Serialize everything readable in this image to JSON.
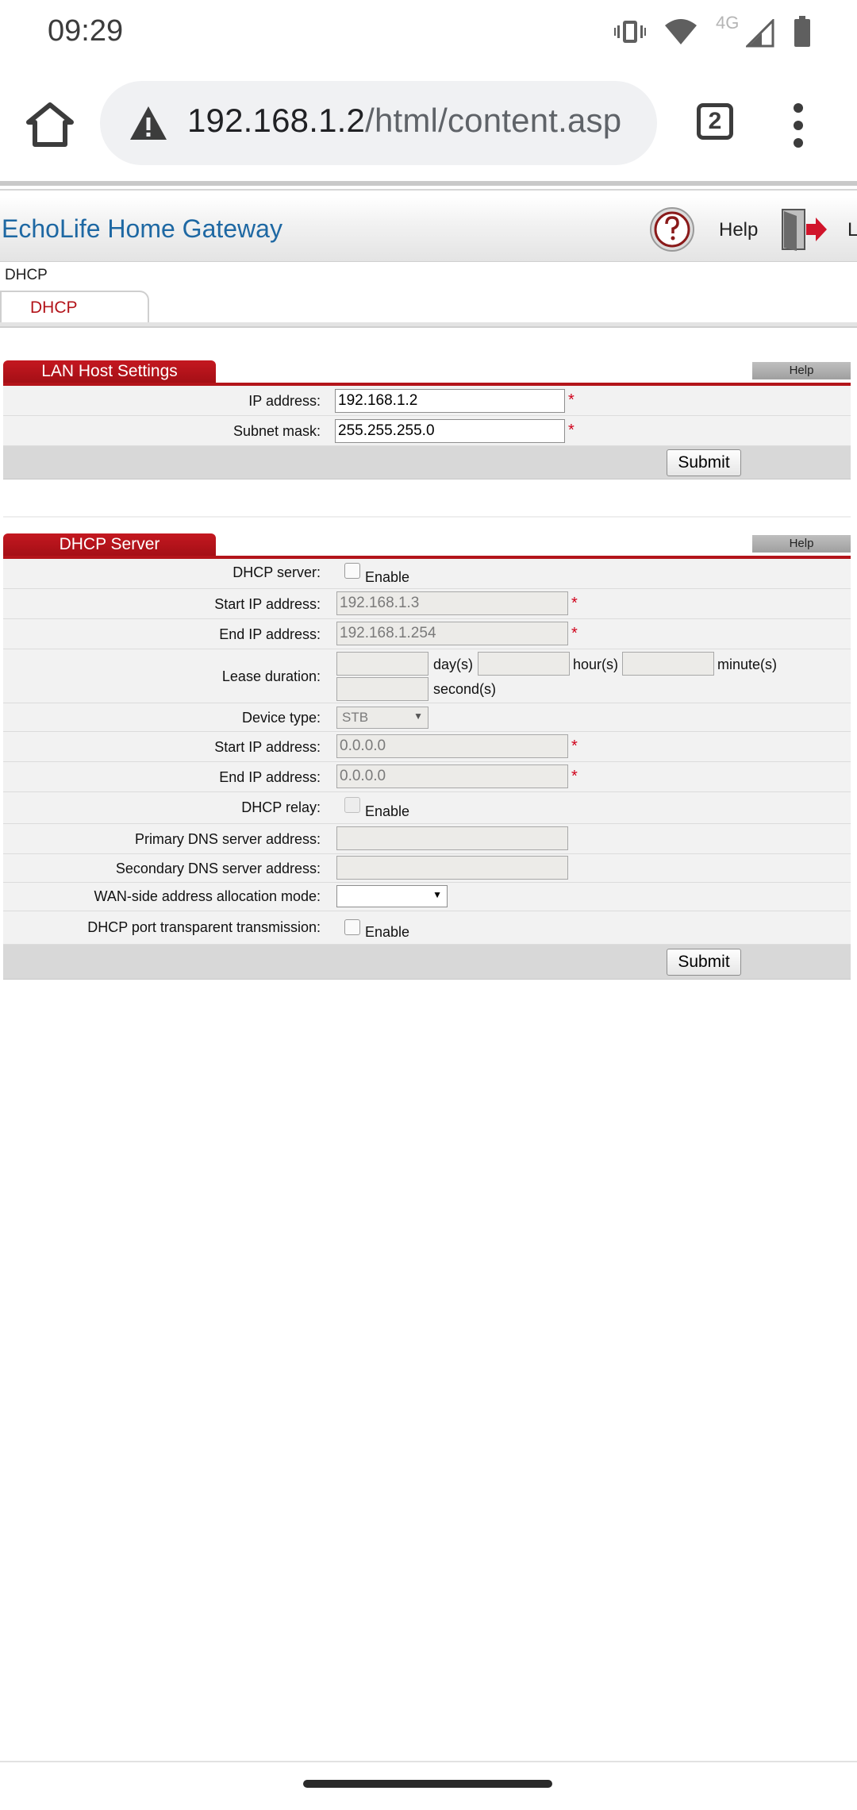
{
  "status_bar": {
    "time": "09:29",
    "network_label": "4G"
  },
  "browser": {
    "url_host": "192.168.1.2",
    "url_path": "/html/content.asp",
    "tab_count": "2"
  },
  "gateway": {
    "title": "EchoLife Home Gateway",
    "help_label": "Help",
    "logout_label": "L"
  },
  "breadcrumb": "DHCP",
  "tab_label": "DHCP",
  "lan_host": {
    "title": "LAN Host Settings",
    "help": "Help",
    "ip_label": "IP address:",
    "ip_value": "192.168.1.2",
    "mask_label": "Subnet mask:",
    "mask_value": "255.255.255.0",
    "required": "*",
    "submit": "Submit"
  },
  "dhcp_server": {
    "title": "DHCP Server",
    "help": "Help",
    "server_label": "DHCP server:",
    "enable": "Enable",
    "start_ip_label": "Start IP address:",
    "start_ip_value": "192.168.1.3",
    "end_ip_label": "End IP address:",
    "end_ip_value": "192.168.1.254",
    "lease_label": "Lease duration:",
    "lease_day": "day(s)",
    "lease_hour": "hour(s)",
    "lease_minute": "minute(s)",
    "lease_second": "second(s)",
    "device_type_label": "Device type:",
    "device_type_value": "STB",
    "stb_start_ip_label": "Start IP address:",
    "stb_start_ip_value": "0.0.0.0",
    "stb_end_ip_label": "End IP address:",
    "stb_end_ip_value": "0.0.0.0",
    "relay_label": "DHCP relay:",
    "relay_enable": "Enable",
    "primary_dns_label": "Primary DNS server address:",
    "secondary_dns_label": "Secondary DNS server address:",
    "wan_mode_label": "WAN-side address allocation mode:",
    "port_transparent_label": "DHCP port transparent transmission:",
    "port_enable": "Enable",
    "required": "*",
    "submit": "Submit"
  },
  "colors": {
    "accent_red": "#b3141a",
    "title_blue": "#1e68a3"
  }
}
